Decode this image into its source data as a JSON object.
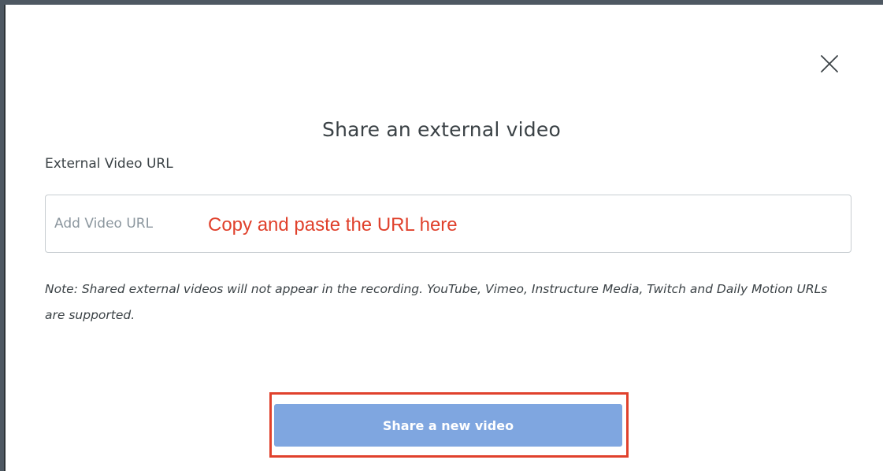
{
  "modal": {
    "title": "Share an external video",
    "close_icon": "close-icon",
    "field_label": "External Video URL",
    "input": {
      "placeholder": "Add Video URL",
      "value": ""
    },
    "annotation": "Copy and paste the URL here",
    "note": "Note: Shared external videos will not appear in the recording. YouTube, Vimeo, Instructure Media, Twitch and Daily Motion URLs are supported.",
    "share_button_label": "Share a new video"
  },
  "colors": {
    "button_bg": "#7fa6e0",
    "annotation_red": "#e0412c",
    "text_dark": "#3b4246",
    "placeholder_gray": "#8b969e",
    "input_border": "#c7cdd1",
    "frame": "#4e5862"
  }
}
